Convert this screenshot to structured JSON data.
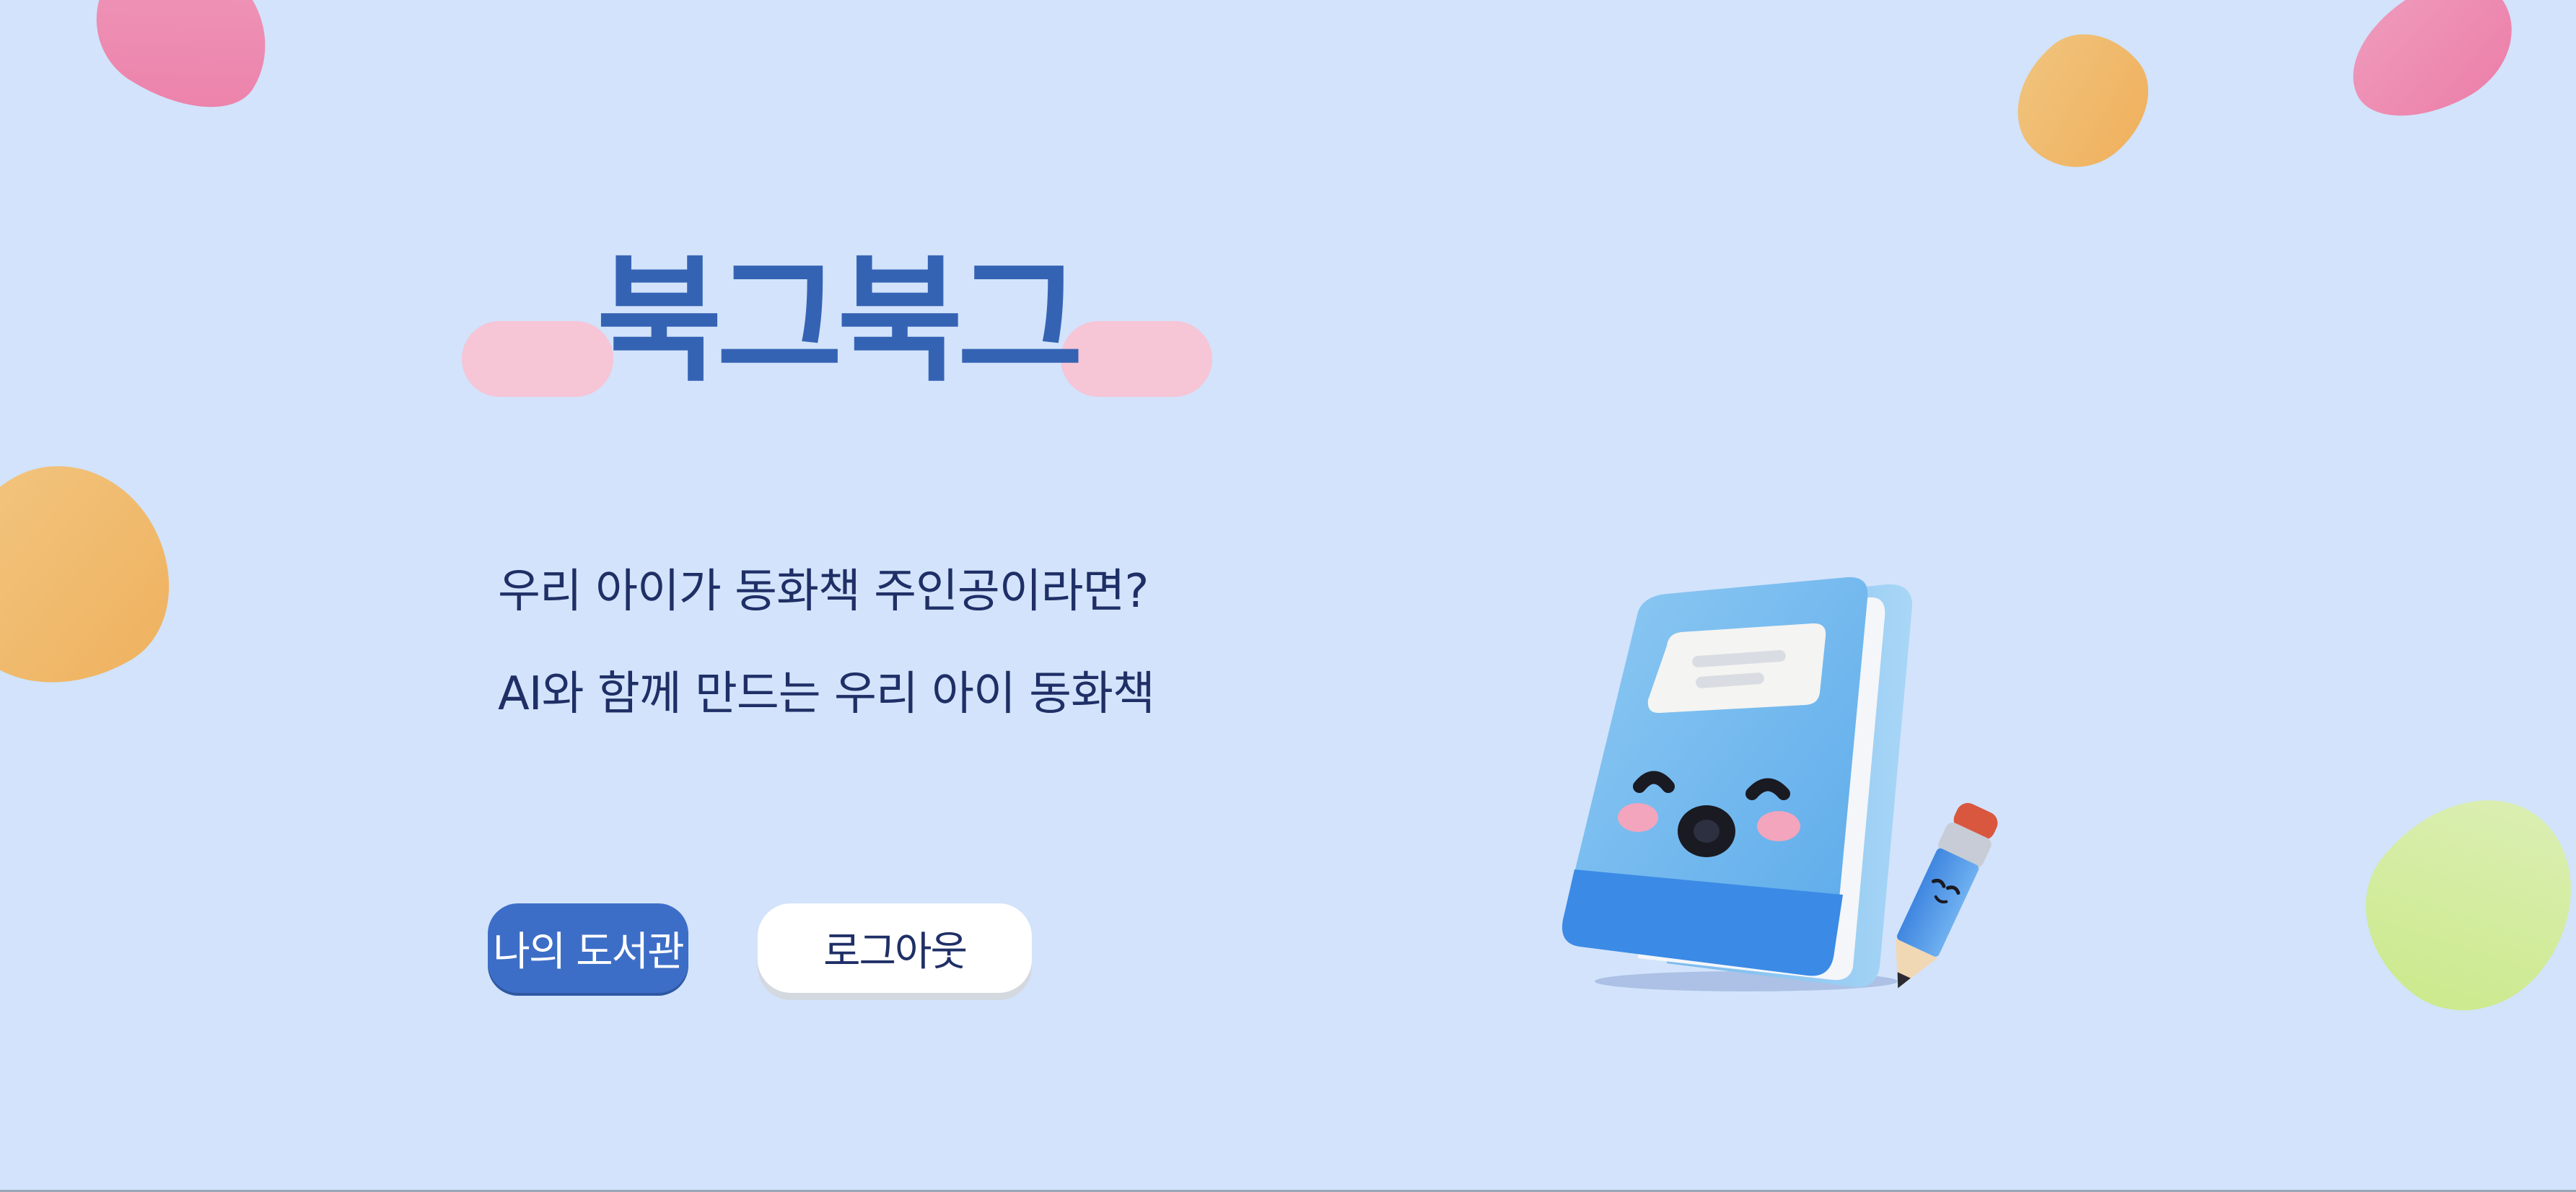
{
  "app": {
    "title": "북그북그"
  },
  "hero": {
    "tagline_line1": "우리 아이가 동화책 주인공이라면?",
    "tagline_line2": "AI와 함께 만드는 우리 아이 동화책"
  },
  "actions": {
    "my_library_label": "나의 도서관",
    "logout_label": "로그아웃"
  },
  "illustration": {
    "icon": "smiling-book-and-pencil-icon"
  },
  "colors": {
    "background": "#d2e3fb",
    "title": "#3563b4",
    "title_highlight": "#f6c5d6",
    "text": "#1f2f66",
    "primary_button": "#3d6ec7",
    "secondary_button": "#ffffff"
  }
}
